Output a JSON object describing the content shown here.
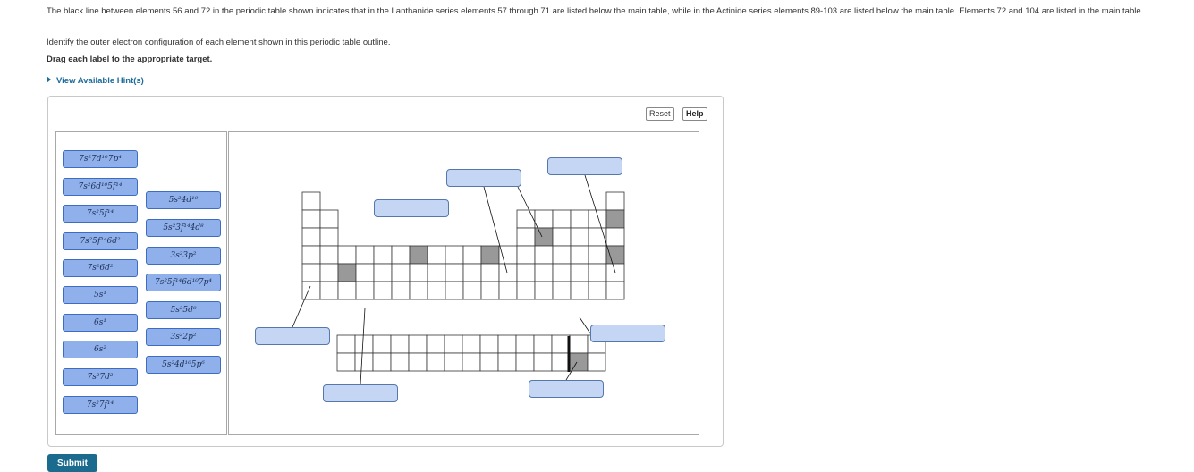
{
  "instructions": {
    "intro": "The black line between elements 56 and 72 in the periodic table shown indicates that in the Lanthanide series elements 57 through 71 are listed below the main table, while in the Actinide series elements 89-103 are listed below the main table. Elements 72 and 104 are listed in the main table.",
    "identify": "Identify the outer electron configuration of each element shown in this periodic table outline.",
    "drag": "Drag each label to the appropriate target.",
    "hint": "View Available Hint(s)"
  },
  "toolbar": {
    "reset": "Reset",
    "help": "Help"
  },
  "labels_col1": [
    "7s²7d¹⁰7p⁴",
    "7s²6d¹⁰5f¹⁴",
    "7s²5f¹⁴",
    "7s²5f¹⁴6d²",
    "7s²6d²",
    "5s¹",
    "6s¹",
    "6s²",
    "7s²7d²",
    "7s²7f¹⁴"
  ],
  "labels_col2": [
    "5s²4d¹⁰",
    "5s²3f¹⁴4d⁸",
    "3s²3p²",
    "7s²5f¹⁴6d¹⁰7p⁴",
    "5s²5d⁸",
    "3s²2p²",
    "5s²4d¹⁰5p⁶"
  ],
  "submit": "Submit",
  "colors": {
    "label_fill": "#8fb0ea",
    "label_border": "#3d6cc0",
    "target_fill": "#c5d6f5",
    "highlight": "#999999",
    "submit": "#1b6b8f"
  }
}
